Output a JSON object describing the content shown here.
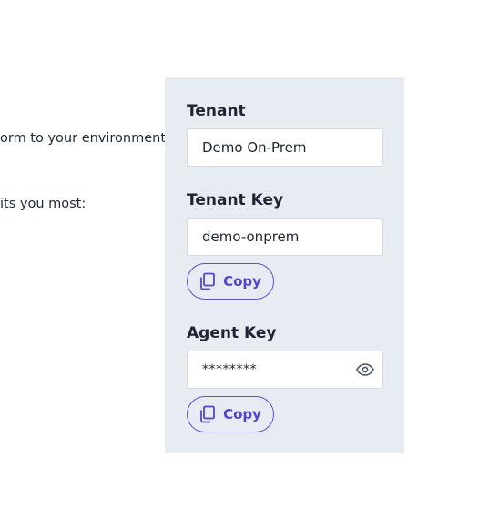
{
  "intro": {
    "line1": "orm to your environment.",
    "line2": "its you most:"
  },
  "panel": {
    "tenant": {
      "label": "Tenant",
      "value": "Demo On-Prem"
    },
    "tenant_key": {
      "label": "Tenant Key",
      "value": "demo-onprem",
      "copy_label": "Copy",
      "copy_icon": "copy-icon"
    },
    "agent_key": {
      "label": "Agent Key",
      "value": "********",
      "toggle_icon": "eye-icon",
      "copy_label": "Copy",
      "copy_icon": "copy-icon"
    }
  },
  "colors": {
    "panel_bg": "#e7ebf2",
    "accent": "#5346c8",
    "text": "#1f2433"
  }
}
